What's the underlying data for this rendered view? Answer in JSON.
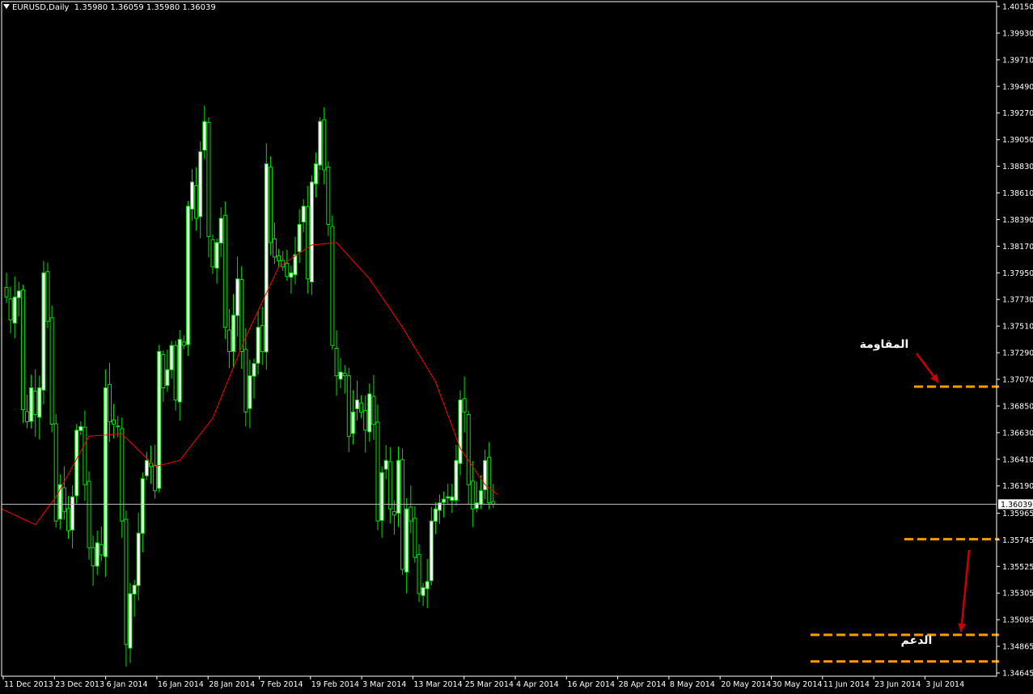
{
  "window": {
    "symbol_timeframe": "EURUSD,Daily",
    "ohlc": "1.35980 1.36059 1.35980 1.36039"
  },
  "colors": {
    "background": "#000000",
    "frame": "#ffffff",
    "candle_up_fill": "#ffffff",
    "candle_outline": "#00e000",
    "moving_average": "#ff0000",
    "price_line": "#c0c0c0",
    "level_line": "#ff9a00",
    "arrow": "#cc0000",
    "text": "#ffffff"
  },
  "chart_data": {
    "type": "candlestick",
    "symbol": "EURUSD",
    "timeframe": "Daily",
    "current_price": 1.36039,
    "ylim": [
      1.34645,
      1.4015
    ],
    "y_ticks": [
      1.4015,
      1.3993,
      1.3971,
      1.3949,
      1.3927,
      1.3905,
      1.3883,
      1.3861,
      1.3839,
      1.3817,
      1.3795,
      1.3773,
      1.3751,
      1.3729,
      1.3707,
      1.3685,
      1.3663,
      1.3641,
      1.3619,
      1.35965,
      1.35745,
      1.35525,
      1.35305,
      1.35085,
      1.34865,
      1.34645
    ],
    "x_ticks": [
      "11 Dec 2013",
      "23 Dec 2013",
      "6 Jan 2014",
      "16 Jan 2014",
      "28 Jan 2014",
      "7 Feb 2014",
      "19 Feb 2014",
      "3 Mar 2014",
      "13 Mar 2014",
      "25 Mar 2014",
      "4 Apr 2014",
      "16 Apr 2014",
      "28 Apr 2014",
      "8 May 2014",
      "20 May 2014",
      "30 May 2014",
      "11 Jun 2014",
      "23 Jun 2014",
      "3 Jul 2014"
    ],
    "closes": [
      1.3775,
      1.3756,
      1.3775,
      1.378,
      1.3682,
      1.3672,
      1.37,
      1.3678,
      1.37,
      1.3795,
      1.3755,
      1.367,
      1.359,
      1.362,
      1.3598,
      1.3582,
      1.361,
      1.3665,
      1.3668,
      1.362,
      1.3568,
      1.3553,
      1.3572,
      1.3562,
      1.37,
      1.3672,
      1.367,
      1.3668,
      1.359,
      1.3488,
      1.353,
      1.3537,
      1.358,
      1.3625,
      1.364,
      1.3635,
      1.3615,
      1.373,
      1.37,
      1.3715,
      1.3735,
      1.369,
      1.374,
      1.3735,
      1.385,
      1.387,
      1.384,
      1.3895,
      1.392,
      1.3825,
      1.38,
      1.382,
      1.384,
      1.375,
      1.373,
      1.376,
      1.379,
      1.373,
      1.368,
      1.371,
      1.372,
      1.375,
      1.373,
      1.3885,
      1.382,
      1.3808,
      1.3805,
      1.38,
      1.3792,
      1.3795,
      1.381,
      1.3835,
      1.385,
      1.379,
      1.387,
      1.3885,
      1.392,
      1.388,
      1.3835,
      1.3735,
      1.371,
      1.3713,
      1.371,
      1.366,
      1.368,
      1.369,
      1.368,
      1.3665,
      1.3695,
      1.367,
      1.359,
      1.363,
      1.364,
      1.36,
      1.3595,
      1.364,
      1.355,
      1.36,
      1.359,
      1.356,
      1.353,
      1.3535,
      1.354,
      1.359,
      1.36,
      1.3605,
      1.3608,
      1.361,
      1.361,
      1.364,
      1.369,
      1.368,
      1.362,
      1.36,
      1.3605,
      1.3615,
      1.364,
      1.3605,
      1.3604
    ],
    "sma_anchors": [
      [
        0,
        1.36
      ],
      [
        7,
        1.3587
      ],
      [
        12,
        1.361
      ],
      [
        20,
        1.366
      ],
      [
        28,
        1.3662
      ],
      [
        36,
        1.3635
      ],
      [
        42,
        1.364
      ],
      [
        50,
        1.3675
      ],
      [
        58,
        1.3742
      ],
      [
        66,
        1.38
      ],
      [
        74,
        1.3818
      ],
      [
        80,
        1.382
      ],
      [
        88,
        1.379
      ],
      [
        96,
        1.375
      ],
      [
        104,
        1.3705
      ],
      [
        110,
        1.365
      ],
      [
        116,
        1.362
      ],
      [
        119,
        1.3612
      ]
    ],
    "levels": [
      {
        "name": "resistance",
        "price": 1.3701,
        "label": "المقاومة"
      },
      {
        "name": "upper-range-support",
        "price": 1.3575
      },
      {
        "name": "support",
        "price": 1.3496,
        "label": "الدعم"
      },
      {
        "name": "lower-support",
        "price": 1.3474
      }
    ]
  },
  "labels": {
    "resistance": "المقاومة",
    "support": "الدعم",
    "current_price_box": "1.36039"
  }
}
